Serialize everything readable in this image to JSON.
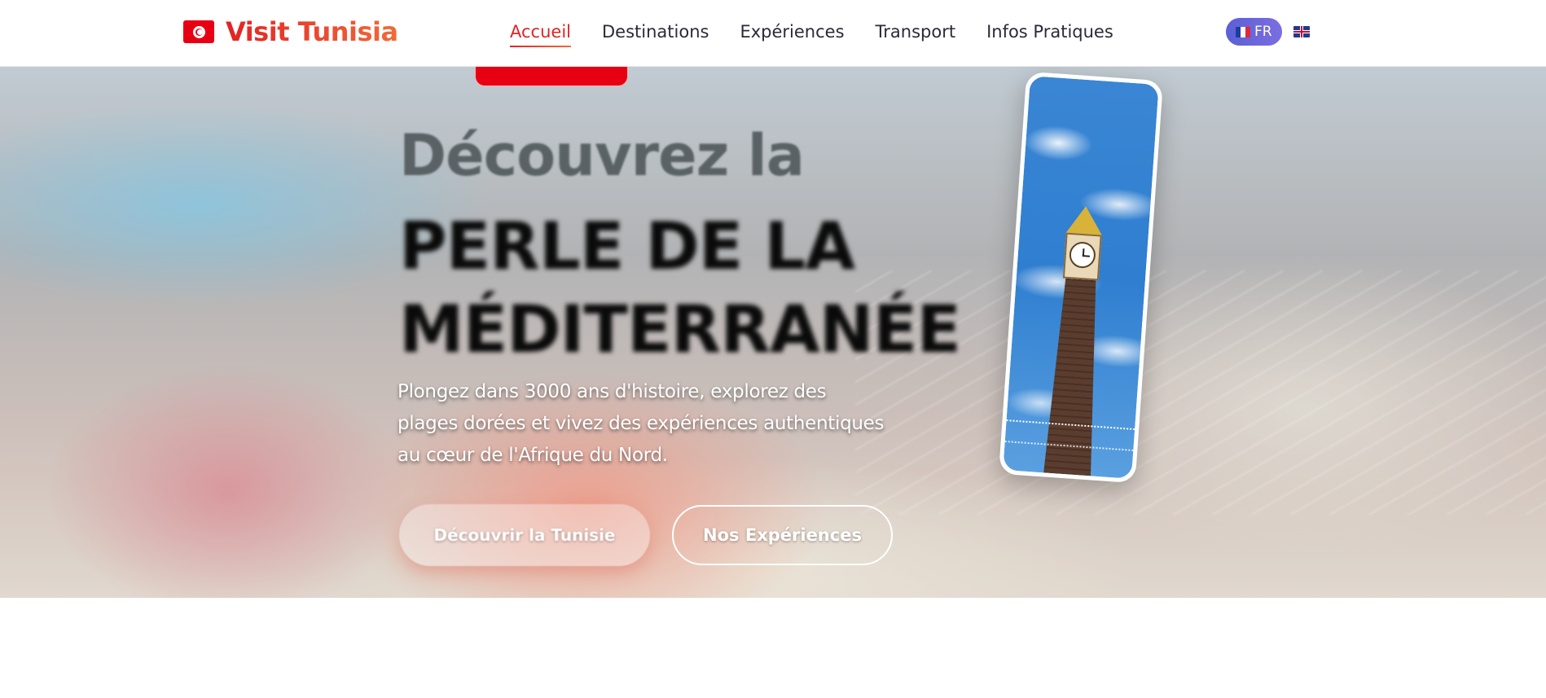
{
  "header": {
    "brand": "Visit Tunisia",
    "nav": [
      {
        "label": "Accueil",
        "active": true
      },
      {
        "label": "Destinations",
        "active": false
      },
      {
        "label": "Expériences",
        "active": false
      },
      {
        "label": "Transport",
        "active": false
      },
      {
        "label": "Infos Pratiques",
        "active": false
      }
    ],
    "lang": {
      "current": "FR",
      "alternate_icon": "uk-flag-icon"
    }
  },
  "hero": {
    "title_line1": "Découvrez la",
    "title_line2": "PERLE DE LA",
    "title_line3": "MÉDITERRANÉE",
    "subtitle": "Plongez dans 3000 ans d'histoire, explorez des plages dorées et vivez des expériences authentiques au cœur de l'Afrique du Nord.",
    "primary_button": "Découvrir la Tunisie",
    "secondary_button": "Nos Expériences",
    "card_image": "clock-tower-tunis-image"
  },
  "colors": {
    "brand_red": "#e02424",
    "brand_orange": "#f26a3a",
    "flag_red": "#e70013",
    "lang_active": "#5b5fd6"
  },
  "icons": [
    "tunisia-flag-icon",
    "france-flag-icon",
    "uk-flag-icon"
  ]
}
